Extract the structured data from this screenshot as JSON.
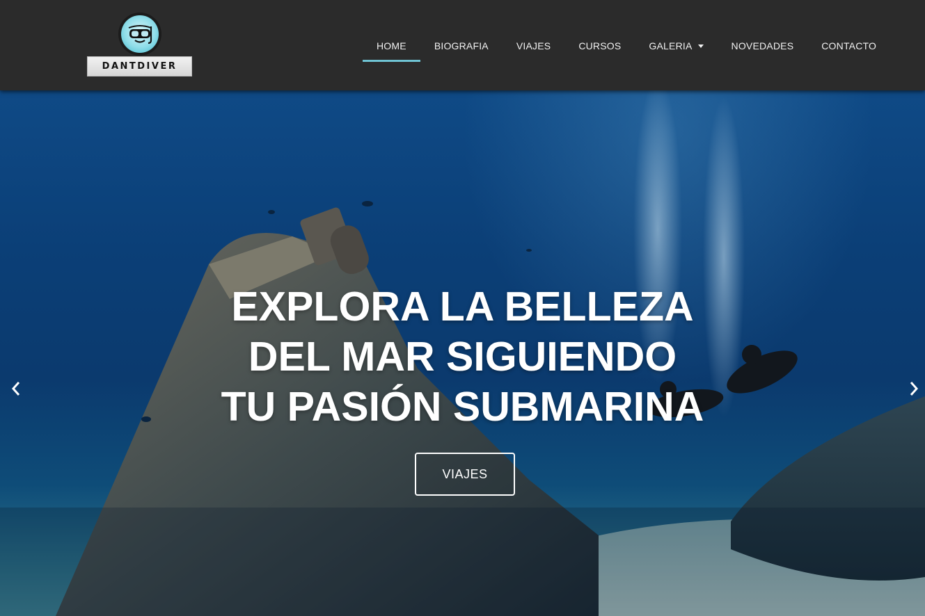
{
  "brand": {
    "name": "DANTDIVER",
    "logo_icon": "diver-mask-icon"
  },
  "nav": {
    "items": [
      {
        "label": "HOME",
        "active": true
      },
      {
        "label": "BIOGRAFIA"
      },
      {
        "label": "VIAJES"
      },
      {
        "label": "CURSOS"
      },
      {
        "label": "GALERIA",
        "dropdown": true
      },
      {
        "label": "NOVEDADES"
      },
      {
        "label": "CONTACTO"
      }
    ],
    "active_color": "#6fc3d3"
  },
  "hero": {
    "lines": [
      "EXPLORA LA BELLEZA",
      "DEL MAR SIGUIENDO",
      "TU PASIÓN SUBMARINA"
    ],
    "cta_label": "VIAJES",
    "prev_icon": "chevron-left-icon",
    "next_icon": "chevron-right-icon"
  },
  "colors": {
    "header_bg": "#2b2b2b",
    "water": "#0b3f77",
    "text": "#ffffff"
  }
}
